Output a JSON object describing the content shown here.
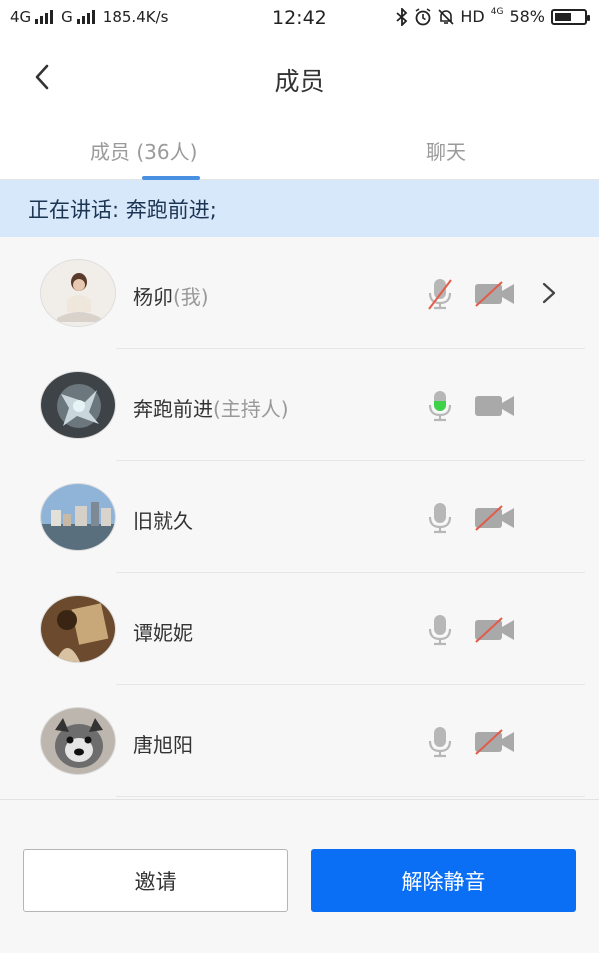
{
  "status_bar": {
    "network_1": "4G",
    "network_2": "G",
    "speed": "185.4K/s",
    "time": "12:42",
    "hd": "HD",
    "net_badge": "4G",
    "battery": "58%",
    "battery_level": 0.58
  },
  "nav": {
    "title": "成员"
  },
  "tabs": {
    "members": "成员 (36人)",
    "chat": "聊天",
    "active": "members",
    "accent_color": "#4a90e2"
  },
  "banner": {
    "speaking_text": "正在讲话: 奔跑前进;"
  },
  "members": [
    {
      "name": "杨卯",
      "role": "(我)",
      "mic": "muted",
      "camera": "off",
      "has_chevron": true
    },
    {
      "name": "奔跑前进",
      "role": "(主持人)",
      "mic": "speaking",
      "camera": "on",
      "has_chevron": false
    },
    {
      "name": "旧就久",
      "role": "",
      "mic": "on",
      "camera": "off",
      "has_chevron": false
    },
    {
      "name": "谭妮妮",
      "role": "",
      "mic": "on",
      "camera": "off",
      "has_chevron": false
    },
    {
      "name": "唐旭阳",
      "role": "",
      "mic": "on",
      "camera": "off",
      "has_chevron": false
    }
  ],
  "footer": {
    "invite_label": "邀请",
    "unmute_label": "解除静音",
    "primary_color": "#0a6ff5"
  },
  "icons": {
    "back": "chevron-left-icon",
    "mic": "microphone-icon",
    "camera": "video-camera-icon",
    "more": "chevron-right-icon"
  }
}
